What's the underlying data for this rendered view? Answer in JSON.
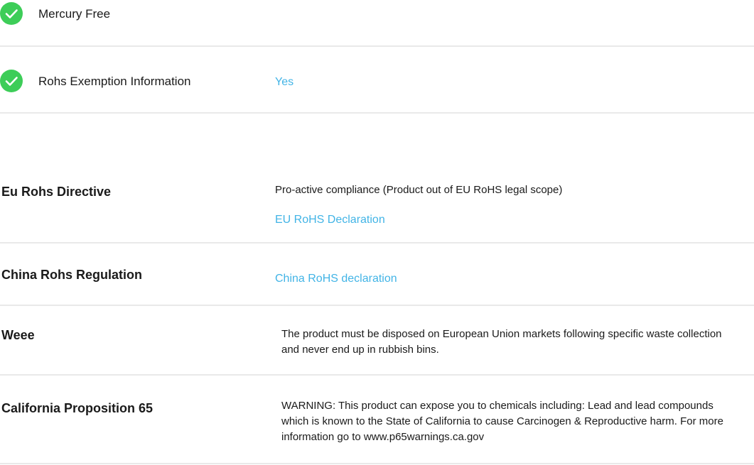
{
  "features": [
    {
      "icon": "check-circle-icon",
      "label": "Mercury Free",
      "value": ""
    },
    {
      "icon": "check-circle-icon",
      "label": "Rohs Exemption Information",
      "value": "Yes"
    }
  ],
  "regulations": {
    "eu_rohs": {
      "label": "Eu Rohs Directive",
      "text": "Pro-active compliance (Product out of EU RoHS legal scope)",
      "link": "EU RoHS Declaration"
    },
    "china_rohs": {
      "label": "China Rohs Regulation",
      "link": "China RoHS declaration"
    },
    "weee": {
      "label": "Weee",
      "text": "The product must be disposed on European Union markets following specific waste collection and never end up in rubbish bins."
    },
    "prop65": {
      "label": "California Proposition 65",
      "text": "WARNING: This product can expose you to chemicals including: Lead and lead compounds which is known to the State of California to cause Carcinogen & Reproductive harm. For more information go to www.p65warnings.ca.gov"
    }
  },
  "colors": {
    "check": "#3dcd58",
    "link": "#42b4e6",
    "divider": "#e9e9e9"
  }
}
